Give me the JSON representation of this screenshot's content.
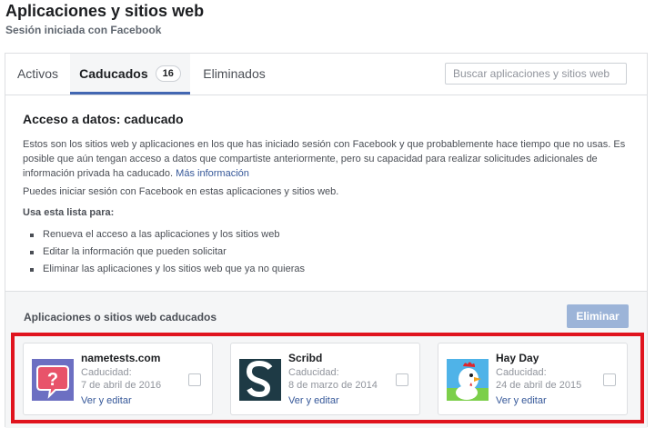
{
  "page": {
    "title": "Aplicaciones y sitios web",
    "subtitle": "Sesión iniciada con Facebook"
  },
  "tabs": [
    {
      "label": "Activos"
    },
    {
      "label": "Caducados",
      "count": "16",
      "active": true
    },
    {
      "label": "Eliminados"
    }
  ],
  "search": {
    "placeholder": "Buscar aplicaciones y sitios web"
  },
  "info": {
    "heading": "Acceso a datos: caducado",
    "paragraph": "Estos son los sitios web y aplicaciones en los que has iniciado sesión con Facebook y que probablemente hace tiempo que no usas. Es posible que aún tengan acceso a datos que compartiste anteriormente, pero su capacidad para realizar solicitudes adicionales de información privada ha caducado.",
    "more_link": "Más información",
    "paragraph2": "Puedes iniciar sesión con Facebook en estas aplicaciones y sitios web.",
    "use_label": "Usa esta lista para:",
    "uses": [
      "Renueva el acceso a las aplicaciones y los sitios web",
      "Editar la información que pueden solicitar",
      "Eliminar las aplicaciones y los sitios web que ya no quieras"
    ]
  },
  "expired": {
    "title": "Aplicaciones o sitios web caducados",
    "remove_label": "Eliminar"
  },
  "apps": [
    {
      "name": "nametests.com",
      "exp_label": "Caducidad:",
      "date": "7 de abril de 2016",
      "edit": "Ver y editar",
      "icon": "nametests-icon"
    },
    {
      "name": "Scribd",
      "exp_label": "Caducidad:",
      "date": "8 de marzo de 2014",
      "edit": "Ver y editar",
      "icon": "scribd-icon"
    },
    {
      "name": "Hay Day",
      "exp_label": "Caducidad:",
      "date": "24 de abril de 2015",
      "edit": "Ver y editar",
      "icon": "hayday-icon"
    }
  ],
  "colors": {
    "accent": "#4267b2",
    "link": "#365899",
    "highlight": "#e0141e",
    "button_disabled": "#9cb4d8"
  }
}
